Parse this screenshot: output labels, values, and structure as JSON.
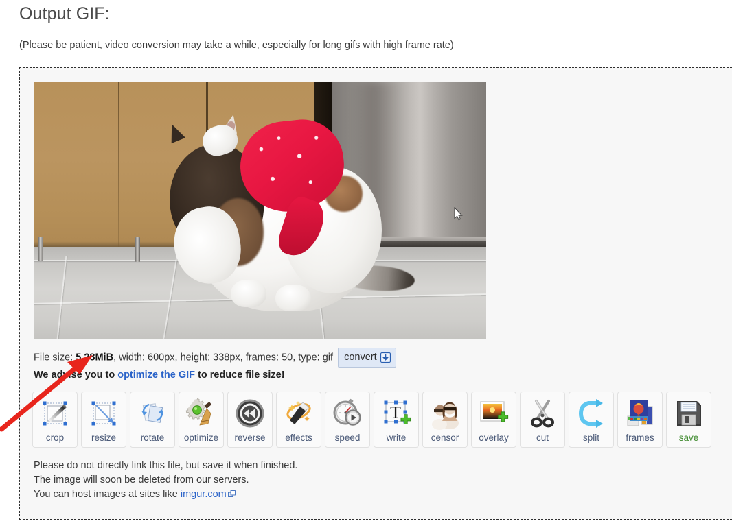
{
  "header": {
    "title": "Output GIF:",
    "patience_note": "(Please be patient, video conversion may take a while, especially for long gifs with high frame rate)"
  },
  "preview": {
    "alt": "animated gif of a white and brown cat wearing a red paw-print bandana grooming itself on a kitchen floor",
    "cursor_icon": "mouse-pointer-icon"
  },
  "file_info": {
    "size_label": "File size: ",
    "size_value": "5.28MiB",
    "rest": ", width: 600px, height: 338px, frames: 50, type: gif",
    "width_px": "600px",
    "height_px": "338px",
    "frames": "50",
    "type": "gif",
    "convert_label": "convert",
    "convert_icon": "download-arrow-icon"
  },
  "advise": {
    "before": "We advise you to ",
    "link": "optimize the GIF",
    "after": " to reduce file size!",
    "link_color": "#2a63c9"
  },
  "tools": [
    {
      "label": "crop",
      "icon": "crop-icon"
    },
    {
      "label": "resize",
      "icon": "resize-icon"
    },
    {
      "label": "rotate",
      "icon": "rotate-icon"
    },
    {
      "label": "optimize",
      "icon": "optimize-icon"
    },
    {
      "label": "reverse",
      "icon": "reverse-icon"
    },
    {
      "label": "effects",
      "icon": "effects-icon"
    },
    {
      "label": "speed",
      "icon": "speed-icon"
    },
    {
      "label": "write",
      "icon": "write-text-icon"
    },
    {
      "label": "censor",
      "icon": "censor-icon"
    },
    {
      "label": "overlay",
      "icon": "overlay-icon"
    },
    {
      "label": "cut",
      "icon": "scissors-icon"
    },
    {
      "label": "split",
      "icon": "split-icon"
    },
    {
      "label": "frames",
      "icon": "frames-icon"
    },
    {
      "label": "save",
      "icon": "floppy-disk-icon"
    }
  ],
  "notes": {
    "line1": "Please do not directly link this file, but save it when finished.",
    "line2": "The image will soon be deleted from our servers.",
    "line3_before": "You can host images at sites like ",
    "line3_link": "imgur.com",
    "line3_icon": "external-link-icon"
  },
  "annotation": {
    "type": "arrow",
    "color": "#e8251c",
    "points_at": "5.28MiB"
  }
}
